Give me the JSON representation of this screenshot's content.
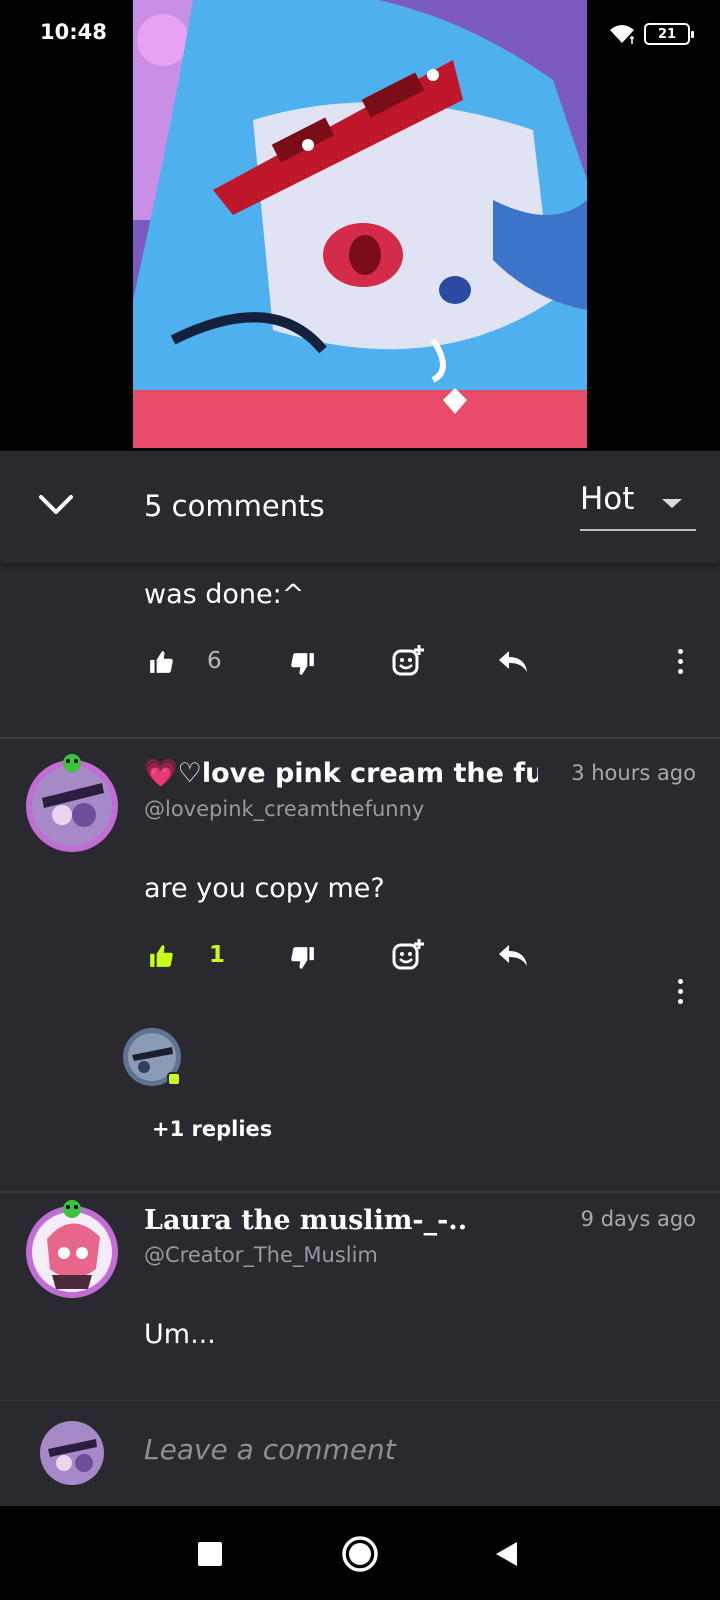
{
  "status_bar": {
    "time": "10:48",
    "battery": "21",
    "icons": [
      "wifi-icon",
      "battery-icon"
    ]
  },
  "header": {
    "comments_count": "5 comments",
    "sort": {
      "selected": "Hot"
    },
    "icons": [
      "chevron-down-icon",
      "caret-down-icon"
    ]
  },
  "comments": [
    {
      "text": "was done:^",
      "likes": "6",
      "liked": false
    },
    {
      "name": "💗♡love pink cream the funny",
      "handle": "@lovepink_creamthefunny",
      "time": "3 hours ago",
      "text": "are you copy me?",
      "likes": "1",
      "liked": true,
      "replies_label": "+1 replies"
    },
    {
      "name": "Laura the muslim-_-..",
      "handle": "@Creator_The_Muslim",
      "time": "9 days ago",
      "text": "Um..."
    }
  ],
  "action_icons": [
    "thumbs-up-icon",
    "thumbs-down-icon",
    "emoji-add-icon",
    "reply-icon",
    "more-vert-icon"
  ],
  "compose": {
    "placeholder": "Leave a comment"
  },
  "nav": {
    "icons": [
      "recents-square-icon",
      "home-circle-icon",
      "back-triangle-icon"
    ]
  },
  "colors": {
    "panel_bg": "#2a2930",
    "accent_liked": "#c8ff1a",
    "secondary_text": "#9a99a3"
  }
}
